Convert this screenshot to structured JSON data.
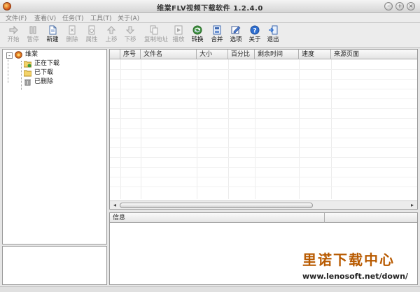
{
  "window": {
    "title": "维棠FLV视频下载软件 1.2.4.0",
    "buttons": {
      "minimize": "–",
      "maximize": "+",
      "close": "×"
    }
  },
  "menu": [
    {
      "label": "文件(F)"
    },
    {
      "label": "查看(V)"
    },
    {
      "label": "任务(T)"
    },
    {
      "label": "工具(T)"
    },
    {
      "label": "关于(A)"
    }
  ],
  "toolbar": [
    {
      "label": "开始",
      "icon": "play-icon",
      "enabled": false
    },
    {
      "label": "暂停",
      "icon": "pause-icon",
      "enabled": false
    },
    {
      "label": "新建",
      "icon": "new-file-icon",
      "enabled": true
    },
    {
      "label": "删除",
      "icon": "delete-icon",
      "enabled": false
    },
    {
      "label": "属性",
      "icon": "properties-icon",
      "enabled": false
    },
    {
      "label": "上移",
      "icon": "move-up-icon",
      "enabled": false
    },
    {
      "label": "下移",
      "icon": "move-down-icon",
      "enabled": false
    },
    {
      "label": "复制地址",
      "icon": "copy-icon",
      "enabled": false
    },
    {
      "label": "播放",
      "icon": "play-media-icon",
      "enabled": false
    },
    {
      "label": "转换",
      "icon": "convert-icon",
      "enabled": true
    },
    {
      "label": "合并",
      "icon": "merge-icon",
      "enabled": true
    },
    {
      "label": "选项",
      "icon": "options-icon",
      "enabled": true
    },
    {
      "label": "关于",
      "icon": "help-icon",
      "enabled": true
    },
    {
      "label": "退出",
      "icon": "exit-icon",
      "enabled": true
    }
  ],
  "tree": {
    "root": {
      "label": "维棠",
      "expander": "-"
    },
    "items": [
      {
        "label": "正在下载",
        "icon": "downloading-folder-icon"
      },
      {
        "label": "已下载",
        "icon": "folder-icon"
      },
      {
        "label": "已删除",
        "icon": "trash-icon"
      }
    ]
  },
  "table": {
    "columns": [
      "序号",
      "文件名",
      "大小",
      "百分比",
      "剩余时间",
      "速度",
      "来源页面"
    ],
    "rows": [],
    "scroll": {
      "left": "◂",
      "right": "▸"
    }
  },
  "info": {
    "header": "信息"
  },
  "watermark": {
    "title": "里诺下载中心",
    "url": "www.lenosoft.net/down/"
  },
  "colors": {
    "accent": "#b85a00",
    "disabled_text": "#9c9c9c"
  }
}
